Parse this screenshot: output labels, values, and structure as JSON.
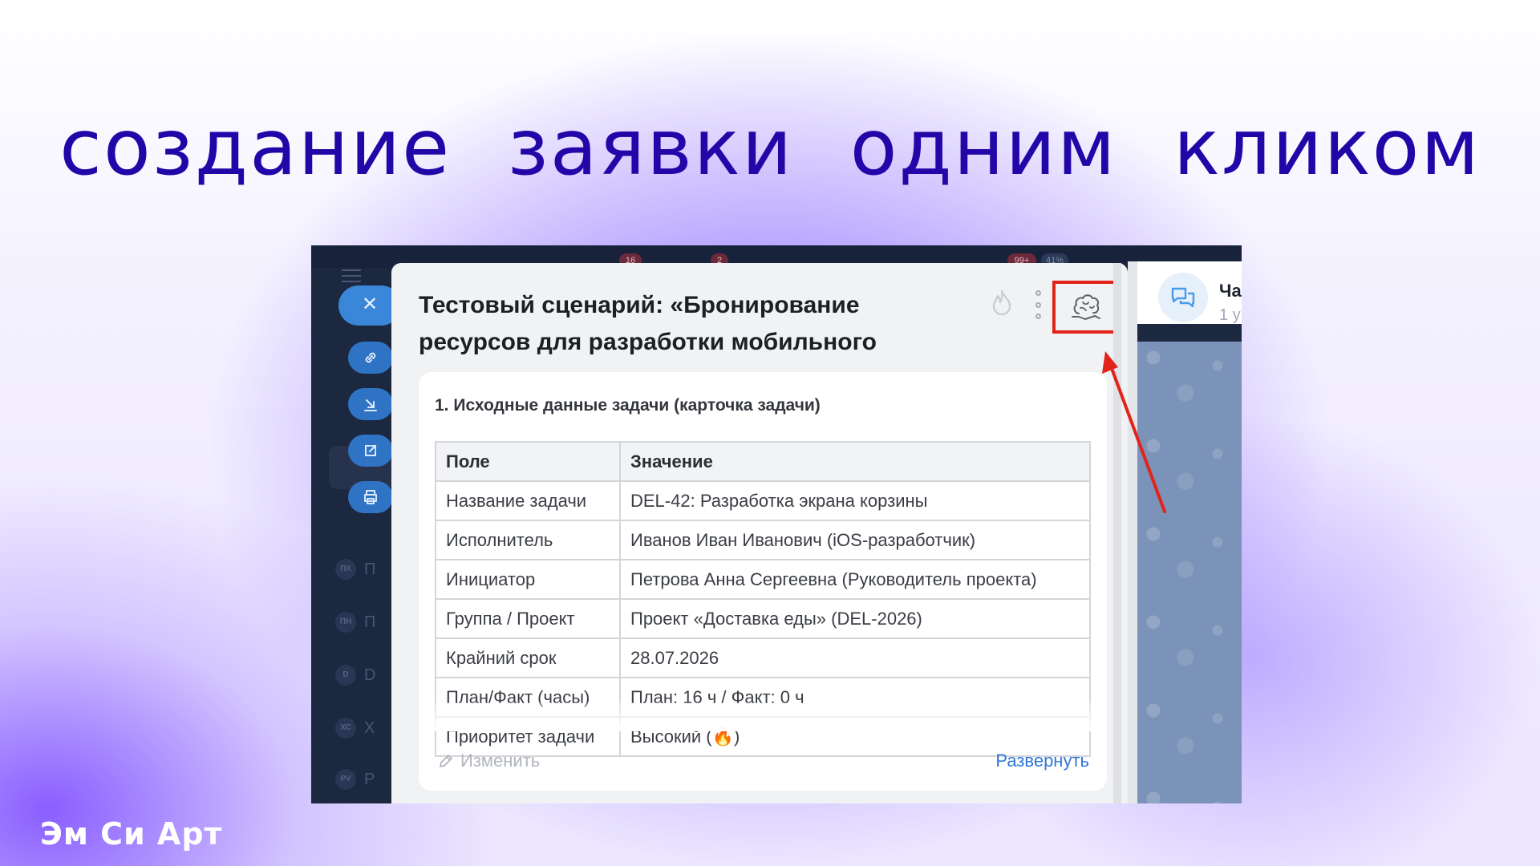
{
  "headline": "создание заявки одним кликом",
  "background_app": {
    "badges": [
      "16",
      "2",
      "99+",
      "41%"
    ],
    "sidebar_letters": [
      {
        "avatar": "ПХ",
        "letter": "П"
      },
      {
        "avatar": "ПН",
        "letter": "П"
      },
      {
        "avatar": "D",
        "letter": "D"
      },
      {
        "avatar": "ХС",
        "letter": "Х"
      },
      {
        "avatar": "PV",
        "letter": "P"
      }
    ]
  },
  "modal": {
    "title": "Тестовый сценарий: «Бронирование ресурсов для разработки мобильного",
    "card": {
      "heading": "1. Исходные данные задачи (карточка задачи)",
      "columns": [
        "Поле",
        "Значение"
      ],
      "rows": [
        [
          "Название задачи",
          "DEL-42: Разработка экрана корзины"
        ],
        [
          "Исполнитель",
          "Иванов Иван Иванович (iOS-разработчик)"
        ],
        [
          "Инициатор",
          "Петрова Анна Сергеевна (Руководитель проекта)"
        ],
        [
          "Группа / Проект",
          "Проект «Доставка еды» (DEL-2026)"
        ],
        [
          "Крайний срок",
          "28.07.2026"
        ],
        [
          "План/Факт (часы)",
          "План: 16 ч / Факт: 0 ч"
        ],
        [
          "Приоритет задачи",
          "Высокий (🔥)"
        ]
      ],
      "edit_label": "Изменить",
      "expand_label": "Развернуть"
    }
  },
  "chat": {
    "name": "Ча",
    "sub": "1 у"
  },
  "icons": {
    "close": "close-icon",
    "link": "link-icon",
    "download": "download-icon",
    "external": "external-link-icon",
    "print": "print-icon",
    "flame": "flame-icon",
    "more": "more-vertical-icon",
    "brain": "brain-icon",
    "pencil": "pencil-icon",
    "chat": "chat-bubbles-icon"
  },
  "colors": {
    "headline": "#2206a8",
    "highlight_box": "#e2231a",
    "accent_link": "#2f78d6",
    "fab": "#3a86d8"
  },
  "brand": "Эм Си Арт"
}
